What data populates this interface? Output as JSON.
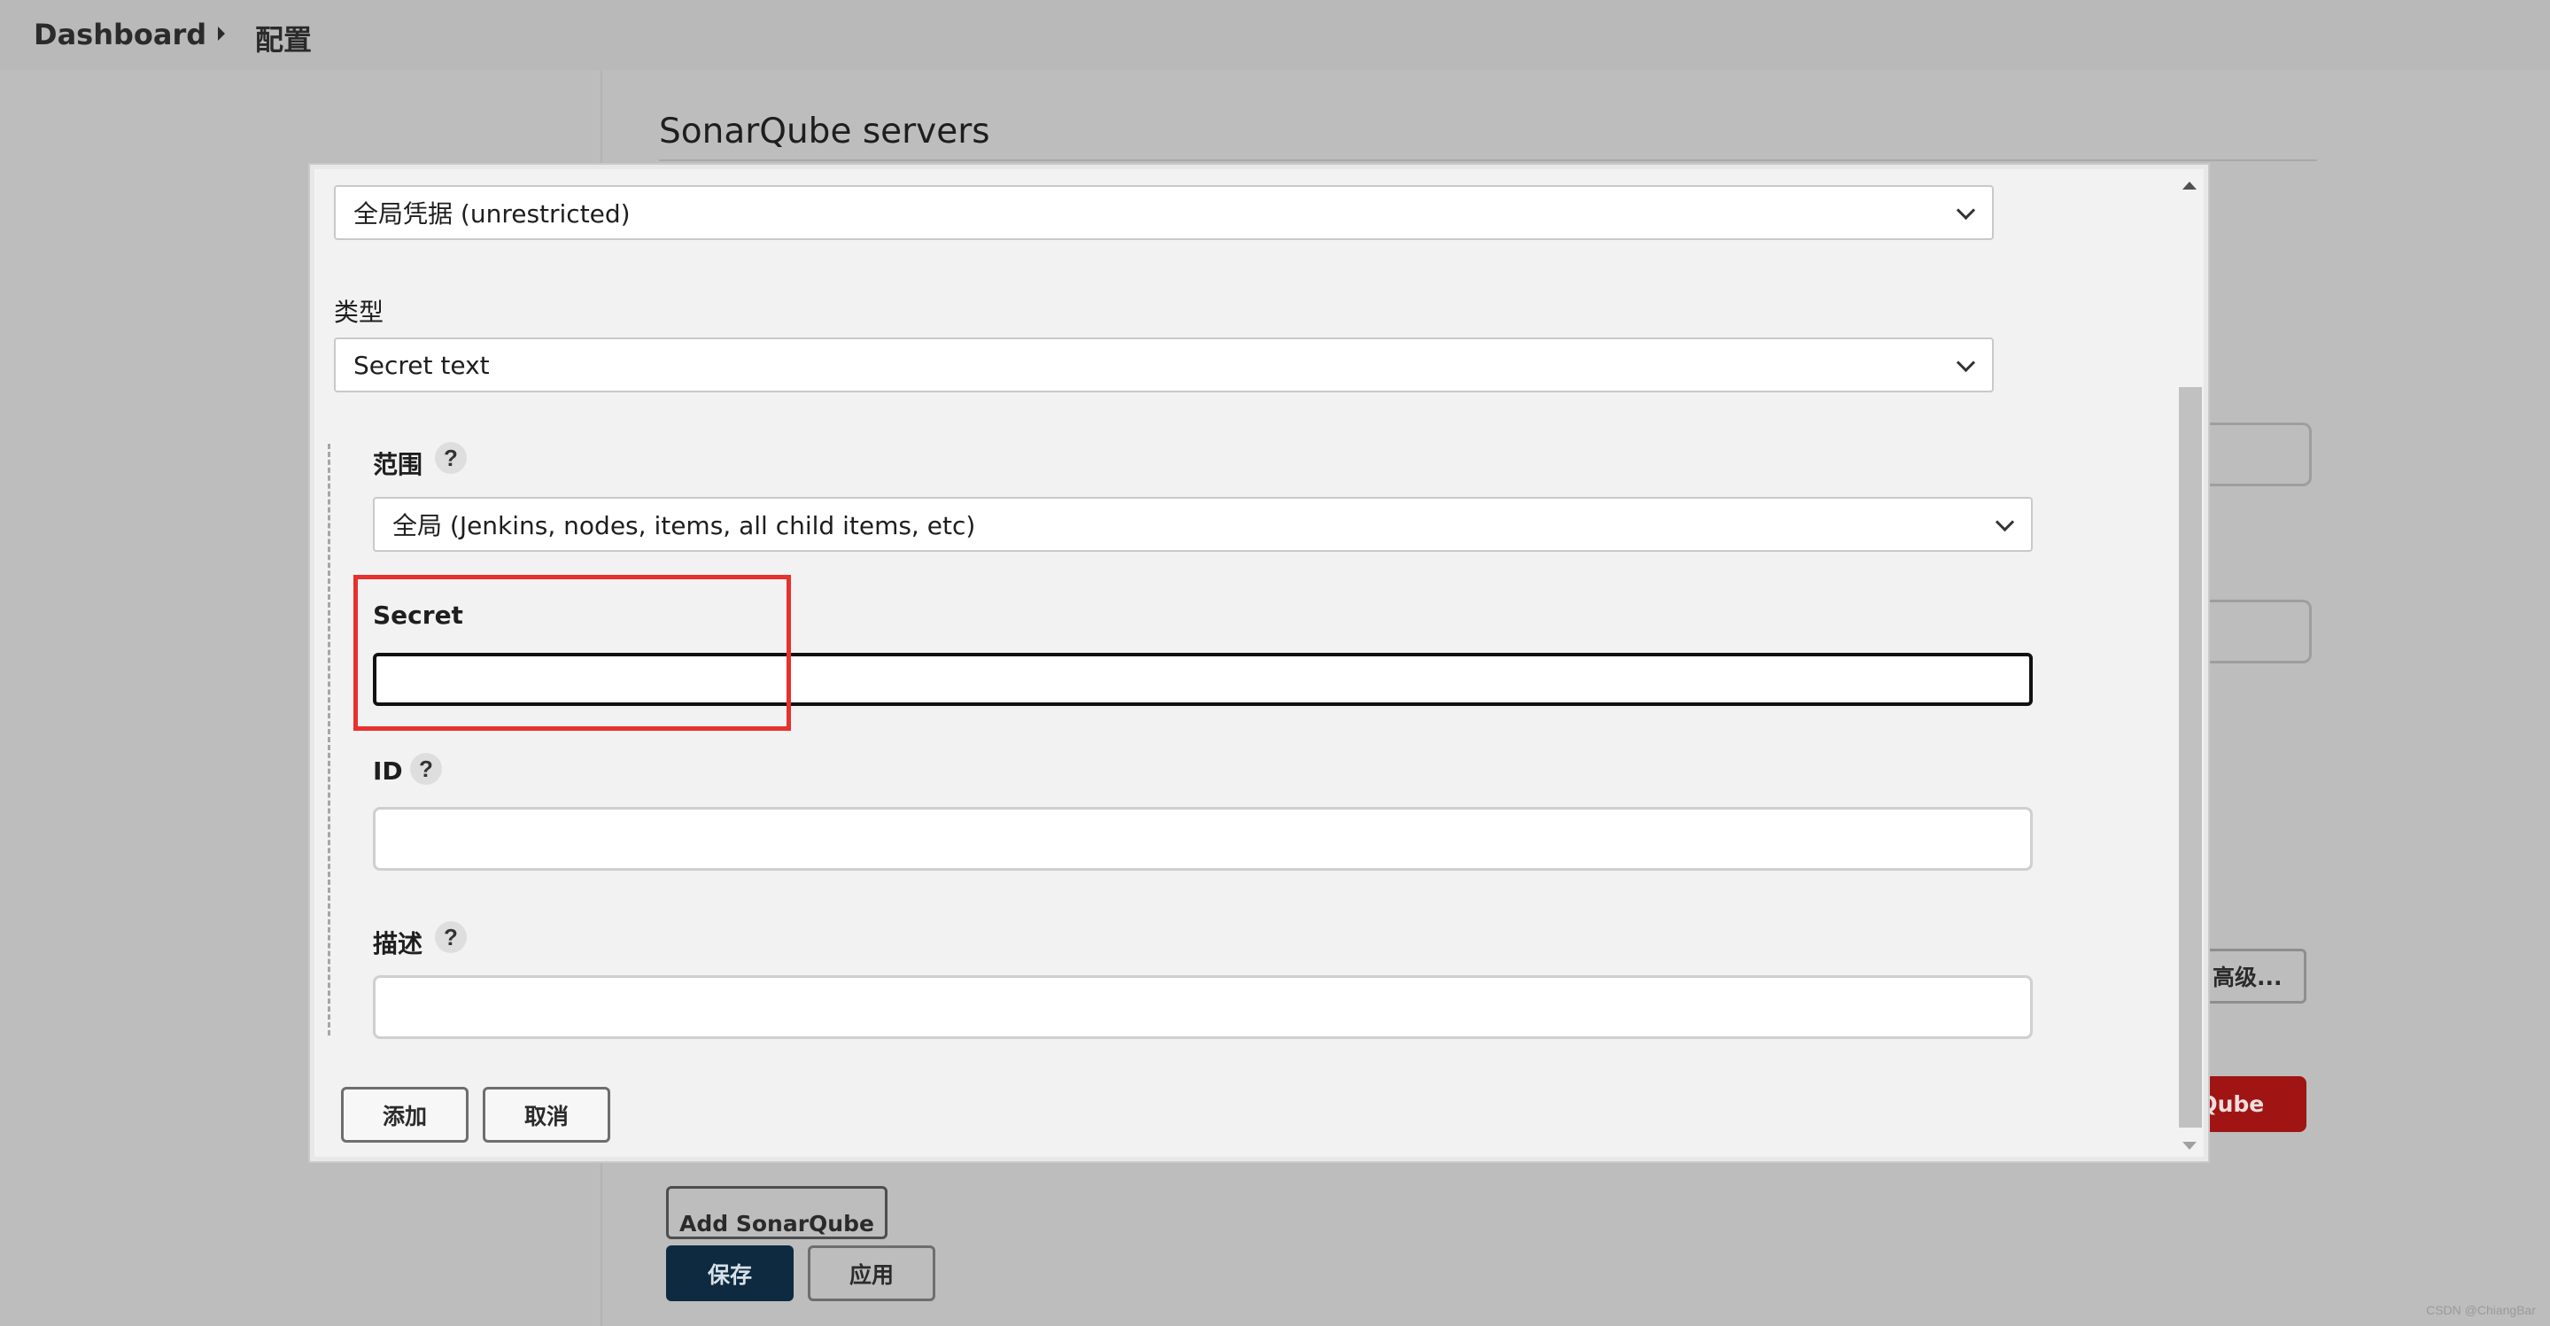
{
  "breadcrumb": {
    "dashboard": "Dashboard",
    "current": "配置"
  },
  "section": {
    "title": "SonarQube servers"
  },
  "background_buttons": {
    "advanced": "高级...",
    "add_sonarqube_partial": "rQube",
    "add_sonarqube": "Add SonarQube",
    "save": "保存",
    "apply": "应用"
  },
  "dialog": {
    "domain_select": {
      "value": "全局凭据 (unrestricted)"
    },
    "type": {
      "label": "类型",
      "value": "Secret text"
    },
    "scope": {
      "label": "范围",
      "value": "全局 (Jenkins, nodes, items, all child items, etc)"
    },
    "secret": {
      "label": "Secret",
      "value": ""
    },
    "id": {
      "label": "ID",
      "value": ""
    },
    "description": {
      "label": "描述",
      "value": ""
    },
    "help_glyph": "?",
    "buttons": {
      "add": "添加",
      "cancel": "取消"
    }
  },
  "watermark": "CSDN @ChiangBar",
  "colors": {
    "highlight": "#e8302d",
    "save_button": "#0e2a40",
    "sonarqube_button": "#a11414"
  }
}
